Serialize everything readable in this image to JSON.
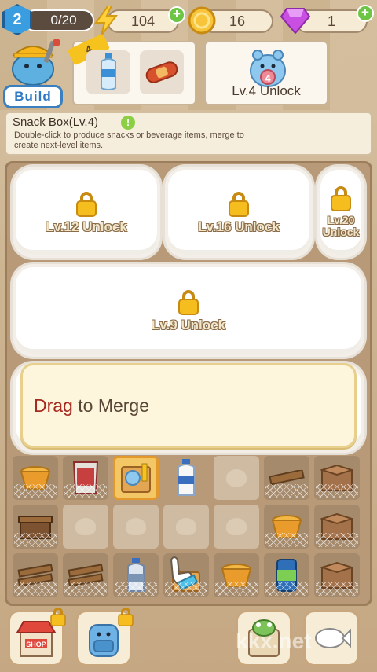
{
  "topbar": {
    "level": "2",
    "xp": "0/20",
    "energy": "104",
    "coins": "16",
    "gems": "1",
    "plus": "+"
  },
  "build": {
    "label": "Build",
    "order_count": "4"
  },
  "unlock_card": {
    "badge": "4",
    "label": "Lv.4 Unlock"
  },
  "info": {
    "title": "Snack Box(Lv.4)",
    "dot": "!",
    "desc": "Double-click to produce snacks or beverage items, merge to create next-level items."
  },
  "board": {
    "locked": [
      {
        "label": "Lv.12 Unlock"
      },
      {
        "label": "Lv.16 Unlock"
      },
      {
        "label": "Lv.20 Unlock"
      },
      {
        "label": "Lv.9 Unlock"
      }
    ],
    "tip_drag": "Drag",
    "tip_rest": " to Merge"
  },
  "grid_items": [
    "noodle-cup",
    "chips-bag",
    "snack-box",
    "milk-bottle",
    "empty",
    "plank",
    "cardboard-box",
    "open-box",
    "empty",
    "empty",
    "empty",
    "empty",
    "noodle-cup",
    "cardboard-box",
    "planks",
    "planks",
    "water-bottle",
    "producer",
    "noodle-cup",
    "soda-can",
    "cardboard-box"
  ],
  "nav": {
    "shop_label": "SHOP"
  },
  "watermark": "kkx.net"
}
